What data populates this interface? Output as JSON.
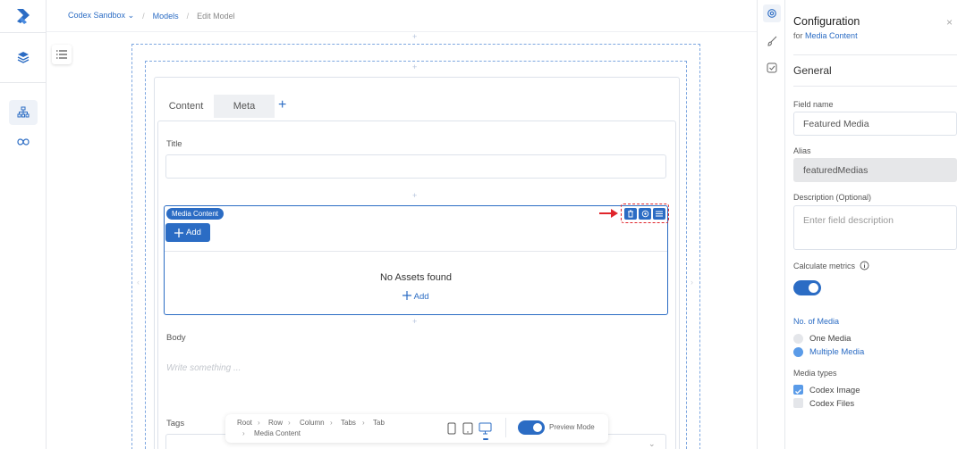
{
  "breadcrumb": {
    "workspace": "Codex Sandbox",
    "workspace_caret": "⌄",
    "models": "Models",
    "current": "Edit Model",
    "sep": "/"
  },
  "canvas": {
    "tabs": [
      {
        "label": "Content"
      },
      {
        "label": "Meta"
      }
    ],
    "tab_add": "+",
    "title_label": "Title",
    "media_chip": "Media Content",
    "add_button": "Add",
    "no_assets": "No Assets found",
    "add_link": "Add",
    "body_label": "Body",
    "body_placeholder": "Write something ...",
    "tags_label": "Tags",
    "plus": "+"
  },
  "bottom_bar": {
    "path": [
      "Root",
      "Row",
      "Column",
      "Tabs",
      "Tab"
    ],
    "path_last": "Media Content",
    "preview_label": "Preview Mode"
  },
  "config": {
    "title": "Configuration",
    "for_prefix": "for",
    "for_target": "Media Content",
    "close": "×",
    "section": "General",
    "field_name_label": "Field name",
    "field_name_value": "Featured Media",
    "alias_label": "Alias",
    "alias_value": "featuredMedias",
    "description_label": "Description (Optional)",
    "description_placeholder": "Enter field description",
    "calc_metrics_label": "Calculate metrics",
    "no_of_media_label": "No. of Media",
    "options_media": [
      {
        "label": "One Media",
        "selected": false
      },
      {
        "label": "Multiple Media",
        "selected": true
      }
    ],
    "media_types_label": "Media types",
    "media_types": [
      {
        "label": "Codex Image",
        "checked": true
      },
      {
        "label": "Codex Files",
        "checked": false
      }
    ]
  },
  "colors": {
    "accent": "#2b6cc4",
    "highlight": "#e0252b"
  }
}
